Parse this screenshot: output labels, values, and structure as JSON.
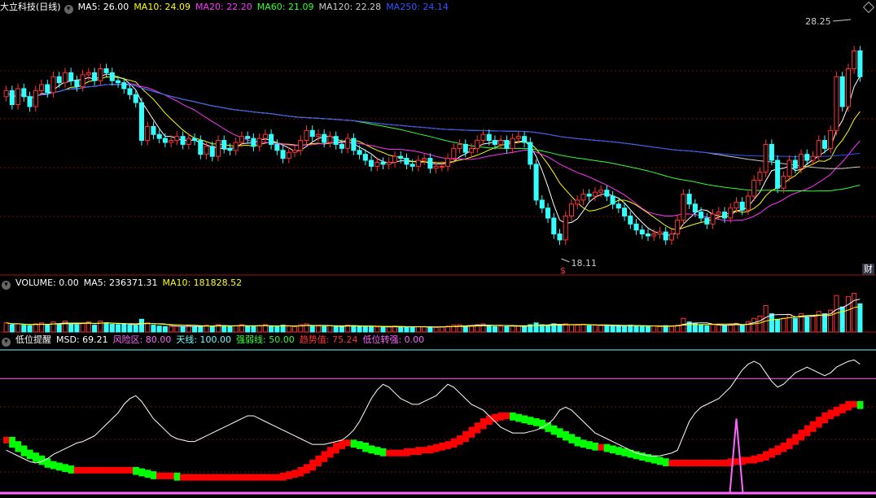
{
  "header": {
    "stock_name": "大立科技(日线)",
    "ma_labels": [
      {
        "text": "MA5: 26.00",
        "color": "#ffffff"
      },
      {
        "text": "MA10: 24.09",
        "color": "#ffff00"
      },
      {
        "text": "MA20: 22.20",
        "color": "#ff33ff"
      },
      {
        "text": "MA60: 21.09",
        "color": "#33ff33"
      },
      {
        "text": "MA120: 22.28",
        "color": "#cccccc"
      },
      {
        "text": "MA250: 24.14",
        "color": "#3355ff"
      }
    ],
    "corner_icon": "diamond-icon",
    "finance_tag": "财",
    "dividend_mark": "$"
  },
  "volume_panel": {
    "labels": [
      {
        "text": "VOLUME: 0.00",
        "color": "#ffffff"
      },
      {
        "text": "MA5: 236371.31",
        "color": "#ffffff"
      },
      {
        "text": "MA10: 181828.52",
        "color": "#ffff00"
      }
    ]
  },
  "indicator_panel": {
    "labels": [
      {
        "text": "低位提醒",
        "color": "#ffffff"
      },
      {
        "text": "MSD: 69.21",
        "color": "#ffffff"
      },
      {
        "text": "风险区: 80.00",
        "color": "#ff66ff"
      },
      {
        "text": "天线: 100.00",
        "color": "#66ffff"
      },
      {
        "text": "强弱线: 50.00",
        "color": "#33ff33"
      },
      {
        "text": "趋势值: 75.24",
        "color": "#ff3333"
      },
      {
        "text": "低位转强: 0.00",
        "color": "#ff66ff"
      }
    ]
  },
  "chart_data": {
    "type": "candlestick",
    "price_range": [
      17,
      30
    ],
    "high_label": "28.25",
    "low_label": "18.11",
    "colors": {
      "up": "#ff3333",
      "down": "#33ffff",
      "ma5": "#ffffff",
      "ma10": "#ffff00",
      "ma20": "#ff33ff",
      "ma60": "#33ff33",
      "ma120": "#cccccc",
      "ma250": "#3355ff",
      "trend_up": "#ff0000",
      "trend_down": "#00ff00",
      "msd": "#ffffff",
      "risk": "#ff66ff",
      "antenna": "#66ffff",
      "signal": "#ff66ff"
    },
    "closes": [
      26.1,
      25.4,
      26.2,
      25.8,
      25.3,
      26.1,
      26.4,
      26.0,
      26.8,
      26.5,
      27.0,
      26.6,
      26.3,
      26.9,
      27.0,
      26.6,
      27.2,
      27.0,
      26.6,
      26.5,
      26.2,
      25.9,
      25.5,
      23.6,
      24.3,
      23.9,
      23.7,
      23.5,
      23.6,
      23.8,
      23.4,
      23.7,
      23.6,
      22.9,
      23.3,
      22.8,
      23.6,
      23.2,
      23.1,
      23.5,
      23.8,
      23.7,
      23.3,
      23.7,
      23.9,
      23.4,
      23.1,
      22.7,
      23.0,
      23.1,
      23.6,
      24.1,
      23.8,
      23.9,
      23.5,
      23.8,
      23.4,
      23.2,
      23.7,
      23.1,
      22.9,
      22.6,
      22.3,
      22.5,
      22.4,
      22.5,
      22.8,
      22.7,
      22.4,
      22.3,
      22.6,
      22.7,
      22.2,
      22.3,
      22.3,
      22.7,
      23.2,
      23.4,
      23.0,
      23.2,
      23.6,
      23.9,
      23.6,
      23.4,
      23.6,
      23.2,
      23.7,
      23.8,
      23.5,
      22.4,
      20.6,
      20.2,
      19.7,
      18.9,
      18.6,
      19.8,
      20.4,
      20.6,
      20.9,
      20.8,
      21.0,
      21.1,
      20.8,
      20.4,
      20.2,
      19.8,
      19.4,
      19.1,
      18.9,
      18.8,
      18.9,
      19.0,
      18.6,
      18.9,
      19.6,
      20.9,
      20.4,
      20.0,
      19.7,
      19.4,
      19.9,
      20.0,
      19.7,
      20.2,
      20.5,
      20.1,
      20.8,
      21.6,
      22.0,
      23.4,
      22.6,
      21.2,
      21.8,
      22.6,
      22.2,
      22.9,
      22.6,
      22.8,
      23.6,
      23.2,
      24.1,
      26.8,
      25.3,
      27.2,
      28.1,
      26.8
    ],
    "volumes": [
      0.2,
      0.16,
      0.18,
      0.15,
      0.14,
      0.18,
      0.2,
      0.15,
      0.22,
      0.18,
      0.24,
      0.18,
      0.16,
      0.2,
      0.22,
      0.15,
      0.24,
      0.2,
      0.17,
      0.16,
      0.17,
      0.15,
      0.14,
      0.28,
      0.2,
      0.15,
      0.13,
      0.12,
      0.12,
      0.13,
      0.12,
      0.13,
      0.12,
      0.14,
      0.15,
      0.13,
      0.16,
      0.13,
      0.12,
      0.14,
      0.16,
      0.13,
      0.12,
      0.14,
      0.16,
      0.12,
      0.12,
      0.15,
      0.13,
      0.12,
      0.16,
      0.18,
      0.14,
      0.13,
      0.12,
      0.14,
      0.12,
      0.12,
      0.15,
      0.14,
      0.12,
      0.13,
      0.12,
      0.11,
      0.1,
      0.11,
      0.13,
      0.12,
      0.11,
      0.1,
      0.12,
      0.12,
      0.11,
      0.1,
      0.11,
      0.13,
      0.15,
      0.16,
      0.13,
      0.14,
      0.16,
      0.18,
      0.14,
      0.12,
      0.13,
      0.12,
      0.14,
      0.13,
      0.12,
      0.16,
      0.2,
      0.16,
      0.14,
      0.18,
      0.16,
      0.18,
      0.16,
      0.15,
      0.17,
      0.14,
      0.15,
      0.14,
      0.13,
      0.14,
      0.13,
      0.14,
      0.15,
      0.14,
      0.13,
      0.12,
      0.13,
      0.12,
      0.14,
      0.13,
      0.15,
      0.3,
      0.22,
      0.18,
      0.16,
      0.14,
      0.16,
      0.15,
      0.14,
      0.17,
      0.19,
      0.15,
      0.22,
      0.3,
      0.35,
      0.58,
      0.4,
      0.28,
      0.3,
      0.38,
      0.3,
      0.4,
      0.32,
      0.34,
      0.45,
      0.4,
      0.48,
      0.8,
      0.55,
      0.78,
      0.85,
      0.62
    ],
    "msd": [
      30,
      28,
      26,
      24,
      22,
      21,
      22,
      24,
      27,
      29,
      31,
      33,
      35,
      36,
      38,
      40,
      44,
      48,
      52,
      56,
      62,
      66,
      68,
      64,
      58,
      52,
      48,
      44,
      40,
      38,
      37,
      36,
      36,
      38,
      40,
      42,
      44,
      46,
      48,
      50,
      52,
      54,
      54,
      52,
      50,
      48,
      46,
      44,
      42,
      40,
      38,
      36,
      34,
      34,
      34,
      35,
      36,
      37,
      40,
      44,
      50,
      58,
      66,
      72,
      76,
      74,
      70,
      66,
      64,
      62,
      62,
      64,
      66,
      68,
      72,
      76,
      74,
      70,
      66,
      62,
      60,
      58,
      54,
      50,
      46,
      44,
      42,
      42,
      42,
      43,
      44,
      46,
      48,
      52,
      58,
      60,
      58,
      54,
      50,
      46,
      42,
      40,
      38,
      36,
      34,
      32,
      30,
      28,
      27,
      26,
      26,
      26,
      27,
      28,
      30,
      40,
      50,
      56,
      60,
      62,
      64,
      66,
      70,
      74,
      80,
      86,
      90,
      92,
      90,
      84,
      78,
      74,
      76,
      80,
      84,
      86,
      88,
      86,
      84,
      82,
      84,
      88,
      90,
      92,
      93,
      90
    ],
    "trend": [
      37,
      34,
      31,
      28,
      26,
      24,
      22,
      20,
      19,
      18,
      17,
      16,
      16,
      16,
      16,
      16,
      16,
      16,
      16,
      16,
      16,
      16,
      15,
      14,
      13,
      12,
      12,
      12,
      12,
      11,
      11,
      11,
      11,
      11,
      11,
      11,
      11,
      11,
      11,
      11,
      11,
      11,
      11,
      11,
      11,
      11,
      11,
      12,
      13,
      14,
      16,
      18,
      21,
      24,
      27,
      30,
      33,
      35,
      35,
      34,
      33,
      31,
      30,
      29,
      28,
      28,
      28,
      28,
      29,
      29,
      30,
      30,
      31,
      32,
      33,
      34,
      36,
      38,
      41,
      44,
      47,
      50,
      52,
      53,
      54,
      54,
      53,
      52,
      51,
      50,
      49,
      47,
      45,
      43,
      41,
      39,
      37,
      35,
      34,
      33,
      32,
      32,
      31,
      30,
      29,
      28,
      27,
      26,
      25,
      24,
      23,
      22,
      21,
      21,
      21,
      21,
      21,
      21,
      21,
      21,
      21,
      21,
      21,
      22,
      22,
      23,
      23,
      24,
      25,
      27,
      29,
      31,
      33,
      36,
      39,
      42,
      45,
      48,
      51,
      54,
      56,
      58,
      60,
      62,
      62,
      61
    ],
    "low_turn_signal_index": 124,
    "risk_level": 80,
    "antenna_level": 100,
    "strength_line": 50
  }
}
